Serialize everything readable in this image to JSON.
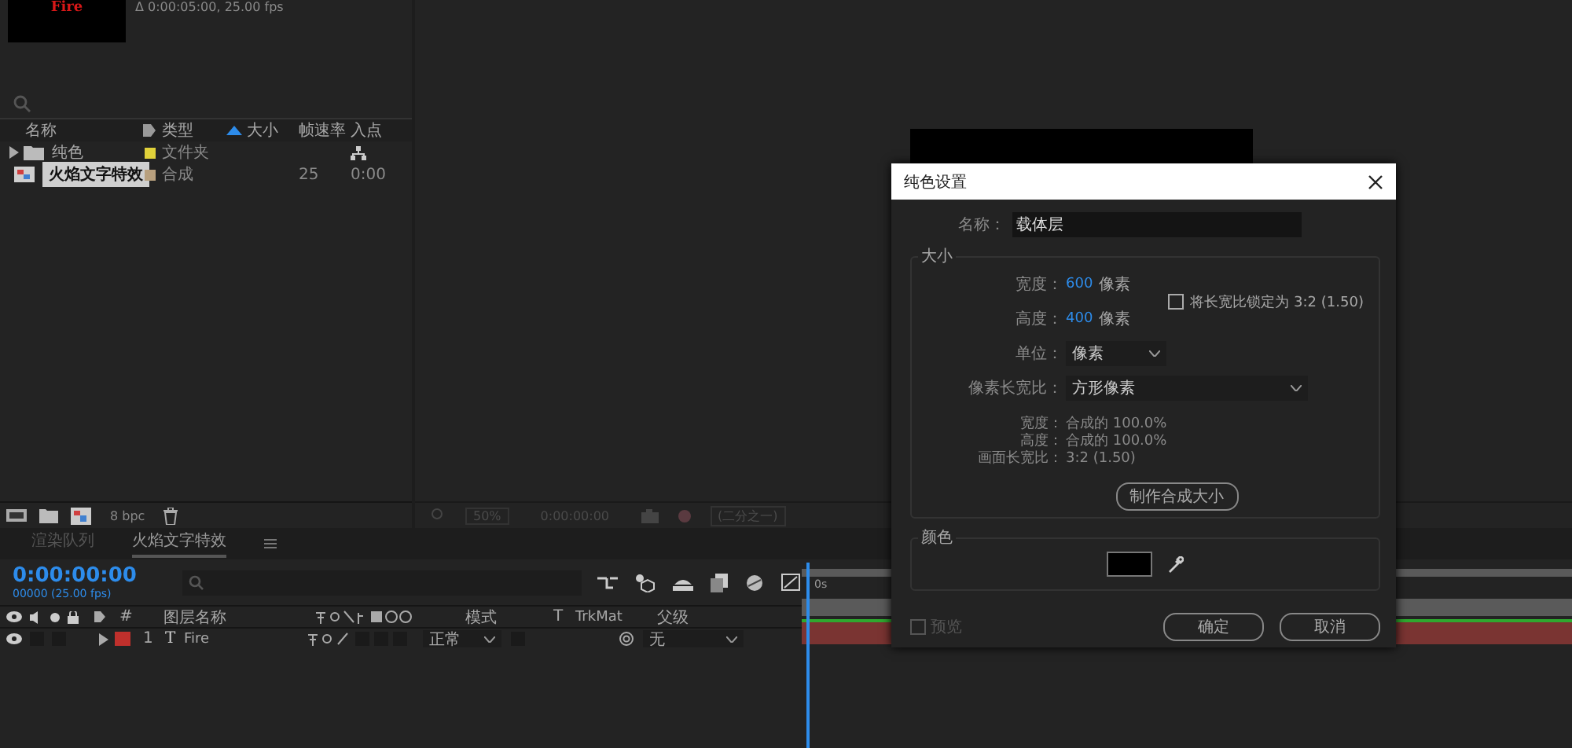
{
  "project_panel": {
    "thumbnail_text": "Fire",
    "comp_info": "Δ 0:00:05:00, 25.00 fps",
    "columns": [
      "名称",
      "类型",
      "大小",
      "帧速率",
      "入点"
    ],
    "items": [
      {
        "name": "纯色",
        "kind": "folder",
        "type": "文件夹",
        "color": "#e0d13a",
        "selected": false
      },
      {
        "name": "火焰文字特效",
        "kind": "composition",
        "type": "合成",
        "color": "#b8a07e",
        "frame_rate": "25",
        "in_point": "0:00",
        "selected": true
      }
    ],
    "bit_depth": "8 bpc"
  },
  "viewer": {
    "zoom": "50%",
    "timecode": "0:00:00:00",
    "resolution": "(二分之一)"
  },
  "timeline": {
    "tabs": [
      {
        "label": "渲染队列",
        "selected": false
      },
      {
        "label": "火焰文字特效",
        "selected": true
      }
    ],
    "current_time": "0:00:00:00",
    "frame_info": "00000 (25.00 fps)",
    "ruler_label": "0s",
    "columns": {
      "number": "#",
      "layer_name": "图层名称",
      "mode": "模式",
      "t": "T",
      "trkmat": "TrkMat",
      "parent": "父级"
    },
    "layers": [
      {
        "number": "1",
        "type_icon": "T",
        "name": "Fire",
        "color": "#c0302c",
        "mode": "正常",
        "parent": "无",
        "visible": true
      }
    ]
  },
  "dialog": {
    "title": "纯色设置",
    "name_label": "名称：",
    "name_value": "载体层",
    "size_group": "大小",
    "width_label": "宽度：",
    "width_value": "600",
    "width_unit": "像素",
    "height_label": "高度：",
    "height_value": "400",
    "height_unit": "像素",
    "lock_ratio": {
      "label": "将长宽比锁定为 3:2 (1.50)",
      "checked": false
    },
    "units_label": "单位：",
    "units_value": "像素",
    "par_label": "像素长宽比：",
    "par_value": "方形像素",
    "info": [
      {
        "label": "宽度：",
        "value": "合成的 100.0%"
      },
      {
        "label": "高度：",
        "value": "合成的 100.0%"
      },
      {
        "label": "画面长宽比：",
        "value": "3:2 (1.50)"
      }
    ],
    "make_comp_size": "制作合成大小",
    "color_group": "颜色",
    "color": "#000000",
    "preview": {
      "label": "预览",
      "checked": false
    },
    "buttons": [
      "确定",
      "取消"
    ]
  }
}
